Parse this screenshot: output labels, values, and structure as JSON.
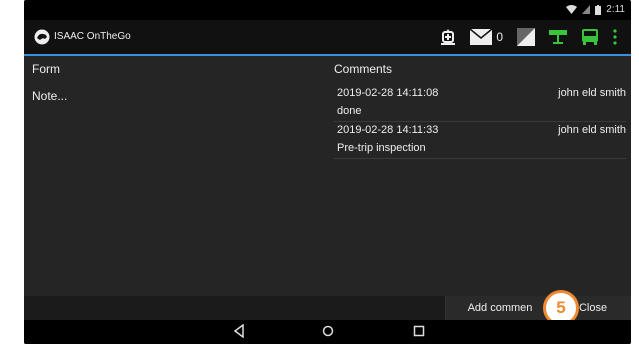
{
  "status_bar": {
    "time": "2:11"
  },
  "app_bar": {
    "title": "ISAAC OnTheGo",
    "mail_count": "0",
    "icons": [
      "logo-icon",
      "alarm-icon",
      "mail-icon",
      "signal-icon",
      "network-icon",
      "truck-icon",
      "more-icon"
    ],
    "accent_color": "#3a8fd8",
    "status_green": "#39c43d"
  },
  "form": {
    "header": "Form",
    "note": "Note..."
  },
  "comments": {
    "header": "Comments",
    "items": [
      {
        "timestamp": "2019-02-28 14:11:08",
        "author": "john eld smith",
        "text": "done"
      },
      {
        "timestamp": "2019-02-28 14:11:33",
        "author": "john eld smith",
        "text": "Pre-trip inspection"
      }
    ]
  },
  "actions": {
    "add_comment": "Add commen",
    "close": "Close"
  },
  "callout": {
    "number": "5",
    "color": "#ef8a2e"
  },
  "nav": {
    "icons": [
      "back-icon",
      "home-icon",
      "recents-icon"
    ]
  }
}
